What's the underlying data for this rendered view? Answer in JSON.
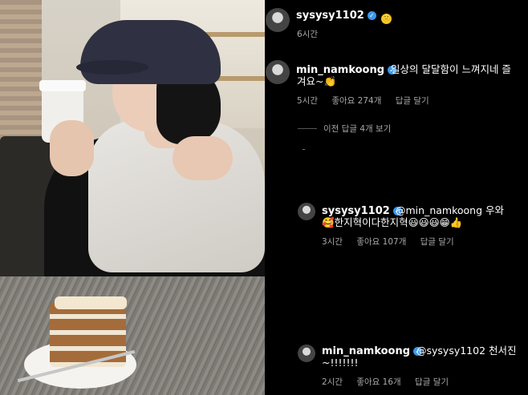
{
  "post": {
    "username": "sysysy1102",
    "emoji": "🙂",
    "time": "6시간"
  },
  "comment1": {
    "username": "min_namkoong",
    "text_line1": "일상의 달달함이 느껴지네 즐",
    "text_line2": "겨요~👏",
    "time": "5시간",
    "likes": "좋아요 274개",
    "reply": "답글 달기"
  },
  "view_replies": "이전 답글 4개 보기",
  "reply1": {
    "username": "sysysy1102",
    "text_line1": "@min_namkoong 우와",
    "text_line2": "🥰한지혁이다한지혁😃😃😃😁👍",
    "time": "3시간",
    "likes": "좋아요 107개",
    "reply": "답글 달기"
  },
  "reply2": {
    "username": "min_namkoong",
    "text_line1": "@sysysy1102 천서진",
    "text_line2": "~!!!!!!!",
    "time": "2시간",
    "likes": "좋아요 16개",
    "reply": "답글 달기"
  },
  "colors": {
    "background": "#000000",
    "secondary_text": "#a8a8a8",
    "verified": "#3897f0"
  },
  "icons": [
    "verified-badge-icon",
    "avatar"
  ]
}
